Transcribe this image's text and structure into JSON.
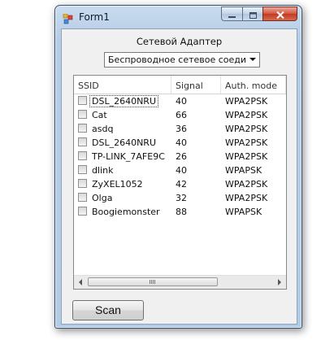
{
  "window": {
    "title": "Form1",
    "icon": "app-form-icon",
    "buttons": {
      "minimize": "minimize-icon",
      "maximize": "maximize-icon",
      "close": "close-icon"
    }
  },
  "adapter": {
    "label": "Сетевой Адаптер",
    "selected": "Беспроводное сетевое соединение"
  },
  "list": {
    "columns": [
      "SSID",
      "Signal",
      "Auth. mode"
    ],
    "rows": [
      {
        "ssid": "DSL_2640NRU",
        "signal": "40",
        "auth": "WPA2PSK"
      },
      {
        "ssid": "Cat",
        "signal": "66",
        "auth": "WPA2PSK"
      },
      {
        "ssid": "asdq",
        "signal": "36",
        "auth": "WPA2PSK"
      },
      {
        "ssid": "DSL_2640NRU",
        "signal": "40",
        "auth": "WPA2PSK"
      },
      {
        "ssid": "TP-LINK_7AFE9C",
        "signal": "26",
        "auth": "WPA2PSK"
      },
      {
        "ssid": "dlink",
        "signal": "40",
        "auth": "WPAPSK"
      },
      {
        "ssid": "ZyXEL1052",
        "signal": "42",
        "auth": "WPA2PSK"
      },
      {
        "ssid": "Olga",
        "signal": "32",
        "auth": "WPA2PSK"
      },
      {
        "ssid": "Boogiemonster",
        "signal": "88",
        "auth": "WPAPSK"
      }
    ]
  },
  "scan_button": {
    "label": "Scan"
  }
}
